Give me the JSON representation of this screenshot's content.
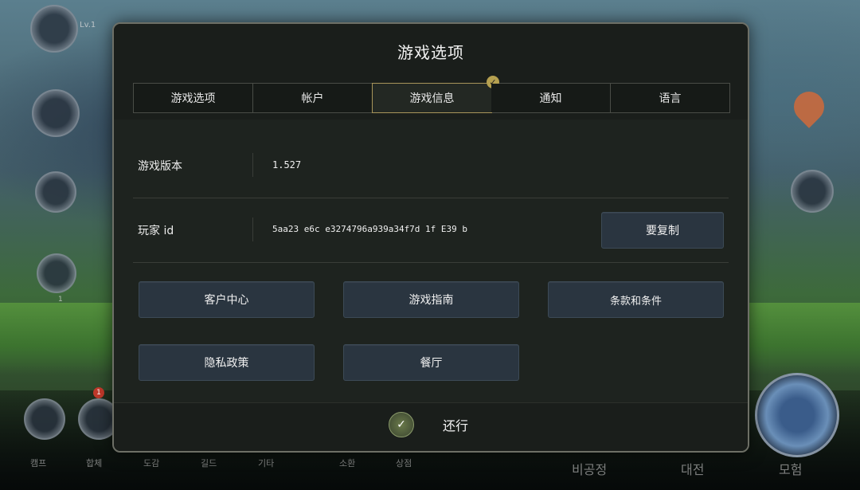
{
  "dialog": {
    "title": "游戏选项"
  },
  "tabs": [
    {
      "label": "游戏选项"
    },
    {
      "label": "帐户"
    },
    {
      "label": "游戏信息"
    },
    {
      "label": "通知"
    },
    {
      "label": "语言"
    }
  ],
  "active_tab_badge": "✓",
  "info": {
    "version_label": "游戏版本",
    "version_value": "1.527",
    "player_id_label": "玩家 id",
    "player_id_value": "5aa23 e6c e3274796a939a34f7d 1f E39 b",
    "copy_button": "要复制"
  },
  "buttons": {
    "customer_center": "客户中心",
    "game_guide": "游戏指南",
    "terms": "条款和条件",
    "privacy": "隐私政策",
    "cafe": "餐厅"
  },
  "footer": {
    "confirm_icon": "✓",
    "confirm_label": "还行"
  },
  "background_hud": {
    "level": "Lv.1",
    "left_small": "1",
    "notification_count": "1",
    "bottom_labels": [
      "캠프",
      "합체",
      "도감",
      "길드",
      "기타",
      "소환",
      "상점"
    ],
    "right_bottom_labels": [
      "비공정",
      "대전",
      "모험"
    ]
  }
}
